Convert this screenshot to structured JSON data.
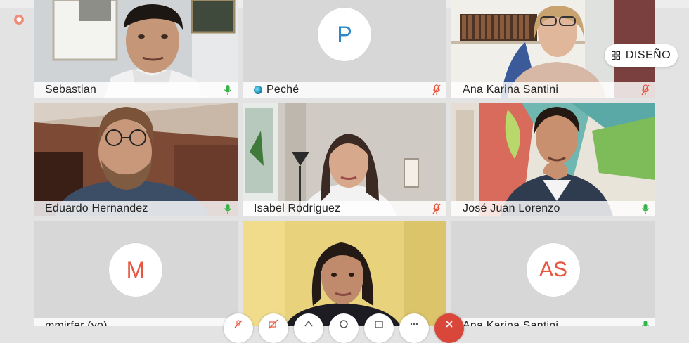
{
  "participants": [
    {
      "name": "Sebastian",
      "mic": "on",
      "type": "video"
    },
    {
      "name": "Peché",
      "initial": "P",
      "mic": "off",
      "type": "avatar",
      "avatar_color": "#2a86c9"
    },
    {
      "name": "Ana Karina Santini",
      "mic": "off",
      "type": "video"
    },
    {
      "name": "Eduardo Hernandez",
      "mic": "on",
      "type": "video"
    },
    {
      "name": "Isabel Rodriguez",
      "mic": "off",
      "type": "video"
    },
    {
      "name": "José Juan Lorenzo",
      "mic": "on",
      "type": "video"
    },
    {
      "name": "mmirfer (yo)",
      "initial": "M",
      "mic": "on",
      "type": "avatar",
      "avatar_color": "#e8563f"
    },
    {
      "name": "",
      "mic": "off",
      "type": "video"
    },
    {
      "name": "Ana Karina Santini",
      "initial": "AS",
      "mic": "on",
      "type": "avatar",
      "avatar_color": "#e8563f"
    }
  ],
  "layout_button": {
    "label": "DISEÑO",
    "icon": "grid-icon"
  },
  "recording_indicator": {
    "icon": "recording-icon"
  },
  "colors": {
    "mic_on": "#36b24a",
    "mic_off": "#e8563f",
    "active_border": "#7cc6e8",
    "hangup": "#d9473b"
  },
  "toolbar": [
    {
      "icon": "mic-muted-icon"
    },
    {
      "icon": "camera-off-icon"
    },
    {
      "icon": "share-icon"
    },
    {
      "icon": "chat-icon"
    },
    {
      "icon": "participants-icon"
    },
    {
      "icon": "more-icon"
    },
    {
      "icon": "hangup-icon"
    }
  ]
}
